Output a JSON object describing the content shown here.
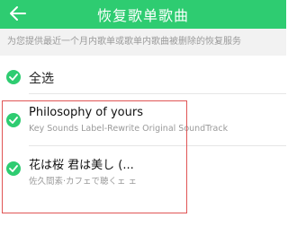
{
  "header": {
    "title": "恢复歌单歌曲",
    "back_icon": "back-arrow-icon"
  },
  "subheader": {
    "text": "为您提供最近一个月内歌单或歌单内歌曲被删除的恢复服务"
  },
  "select_all": {
    "label": "全选",
    "checked": true
  },
  "songs": [
    {
      "title": "Philosophy of yours",
      "subtitle": "Key Sounds Label-Rewrite Original SoundTrack",
      "checked": true
    },
    {
      "title": "花は桜 君は美し (...",
      "subtitle": "佐久間素·カフェで聴くェ                ェ",
      "checked": true
    }
  ],
  "colors": {
    "accent": "#2ecc71",
    "highlight": "#e05555"
  }
}
